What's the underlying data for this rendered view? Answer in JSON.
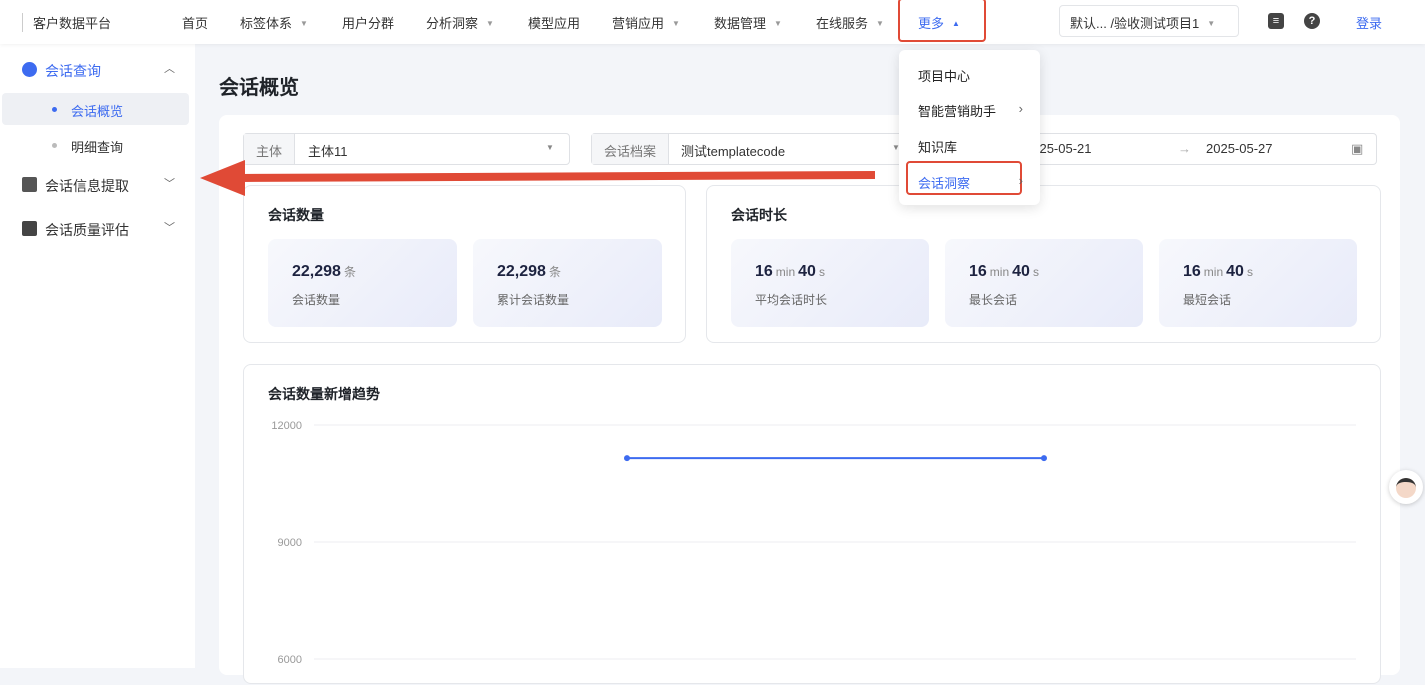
{
  "header": {
    "brand": "客户数据平台",
    "nav": [
      {
        "label": "首页",
        "caret": false
      },
      {
        "label": "标签体系",
        "caret": true
      },
      {
        "label": "用户分群",
        "caret": false
      },
      {
        "label": "分析洞察",
        "caret": true
      },
      {
        "label": "模型应用",
        "caret": false
      },
      {
        "label": "营销应用",
        "caret": true
      },
      {
        "label": "数据管理",
        "caret": true
      },
      {
        "label": "在线服务",
        "caret": true
      },
      {
        "label": "更多",
        "caret": true
      }
    ],
    "project": "默认...  /验收测试项目1",
    "login": "登录",
    "icons": [
      "message-icon",
      "help-icon"
    ]
  },
  "more_menu": {
    "items": [
      {
        "label": "项目中心",
        "sub": false
      },
      {
        "label": "智能营销助手",
        "sub": true
      },
      {
        "label": "知识库",
        "sub": false
      },
      {
        "label": "会话洞察",
        "sub": true,
        "active": true
      }
    ]
  },
  "sidebar": {
    "groups": [
      {
        "label": "会话查询",
        "expanded": true,
        "children": [
          {
            "label": "会话概览",
            "active": true
          },
          {
            "label": "明细查询"
          }
        ]
      },
      {
        "label": "会话信息提取"
      },
      {
        "label": "会话质量评估"
      }
    ]
  },
  "page": {
    "title": "会话概览"
  },
  "filters": {
    "subject_label": "主体",
    "subject_value": "主体11",
    "archive_label": "会话档案",
    "archive_value": "测试templatecode",
    "date_start": "2025-05-21",
    "date_end": "2025-05-27"
  },
  "count_card": {
    "title": "会话数量",
    "stats": [
      {
        "value": "22,298",
        "unit": "条",
        "label": "会话数量"
      },
      {
        "value": "22,298",
        "unit": "条",
        "label": "累计会话数量"
      }
    ]
  },
  "duration_card": {
    "title": "会话时长",
    "stats": [
      {
        "min": "16",
        "sec": "40",
        "label": "平均会话时长"
      },
      {
        "min": "16",
        "sec": "40",
        "label": "最长会话"
      },
      {
        "min": "16",
        "sec": "40",
        "label": "最短会话"
      }
    ],
    "min_unit": "min",
    "sec_unit": "s"
  },
  "chart_data": {
    "type": "line",
    "title": "会话数量新增趋势",
    "y_ticks": [
      "12000",
      "9000",
      "6000"
    ],
    "ylim": [
      6000,
      12000
    ],
    "grid": true,
    "series": [
      {
        "name": "会话数量",
        "color": "#3d6bf0",
        "values": [
          11150,
          11150
        ]
      }
    ]
  }
}
